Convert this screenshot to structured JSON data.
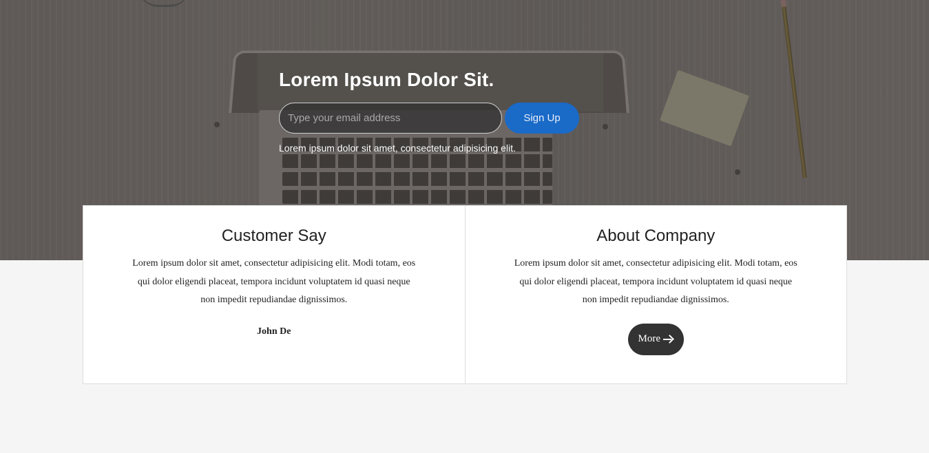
{
  "hero": {
    "title": "Lorem Ipsum Dolor Sit.",
    "email_placeholder": "Type your email address",
    "signup_label": "Sign Up",
    "subtitle": "Lorem ipsum dolor sit amet, consectetur adipisicing elit."
  },
  "cards": {
    "customer": {
      "title": "Customer Say",
      "text": "Lorem ipsum dolor sit amet, consectetur adipisicing elit. Modi totam, eos qui dolor eligendi placeat, tempora incidunt voluptatem id quasi neque non impedit repudiandae dignissimos.",
      "author": "John De"
    },
    "about": {
      "title": "About Company",
      "text": "Lorem ipsum dolor sit amet, consectetur adipisicing elit. Modi totam, eos qui dolor eligendi placeat, tempora incidunt voluptatem id quasi neque non impedit repudiandae dignissimos.",
      "more_label": "More",
      "more_icon": "arrow-right-icon"
    }
  },
  "colors": {
    "accent": "#1a6ac8",
    "dark_button": "#333333",
    "page_background": "#f5f5f5"
  }
}
